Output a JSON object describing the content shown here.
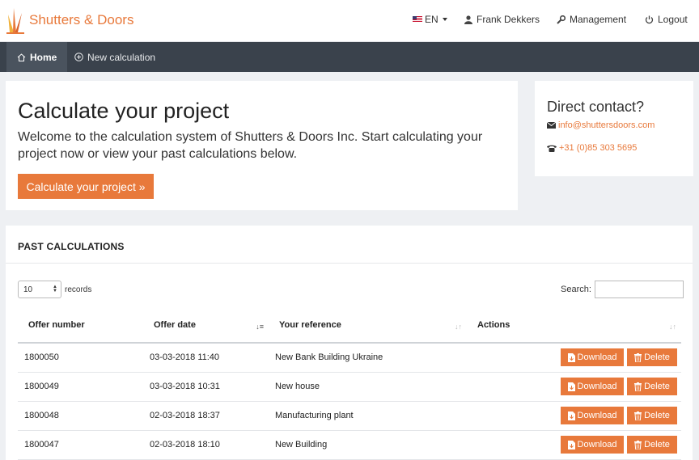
{
  "header": {
    "brand": "Shutters & Doors",
    "language": "EN",
    "user": "Frank Dekkers",
    "management": "Management",
    "logout": "Logout"
  },
  "nav": {
    "home": "Home",
    "new_calculation": "New calculation"
  },
  "hero": {
    "title": "Calculate your project",
    "text": "Welcome to the calculation system of Shutters & Doors Inc. Start calculating your project now or view your past calculations below.",
    "button": "Calculate your project »"
  },
  "contact": {
    "title": "Direct contact?",
    "email": "info@shuttersdoors.com",
    "phone": "+31 (0)85 303 5695"
  },
  "past": {
    "title": "PAST CALCULATIONS",
    "records_value": "10",
    "records_label": "records",
    "search_label": "Search:",
    "search_value": "",
    "columns": [
      "Offer number",
      "Offer date",
      "Your reference",
      "Actions"
    ],
    "download_label": "Download",
    "delete_label": "Delete",
    "rows": [
      {
        "number": "1800050",
        "date": "03-03-2018 11:40",
        "reference": "New Bank Building Ukraine"
      },
      {
        "number": "1800049",
        "date": "03-03-2018 10:31",
        "reference": "New house"
      },
      {
        "number": "1800048",
        "date": "02-03-2018 18:37",
        "reference": "Manufacturing plant"
      },
      {
        "number": "1800047",
        "date": "02-03-2018 18:10",
        "reference": "New Building"
      }
    ]
  },
  "colors": {
    "accent": "#e8793b",
    "nav_bg": "#3a424c",
    "page_bg": "#eef0f3"
  }
}
